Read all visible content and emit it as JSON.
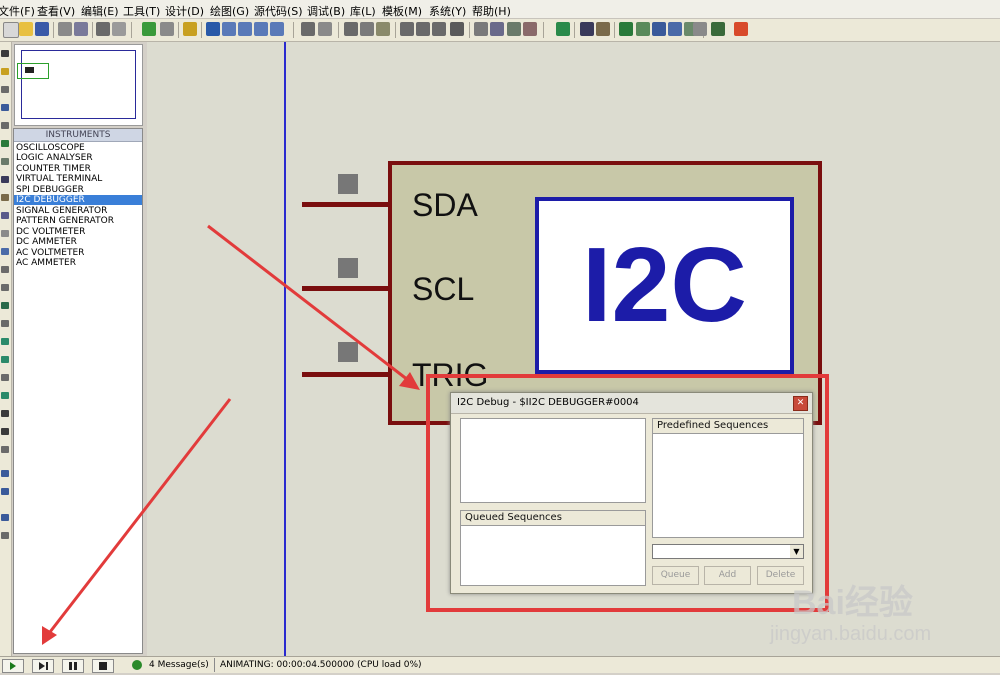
{
  "menu": [
    "文件(F)",
    "查看(V)",
    "编辑(E)",
    "工具(T)",
    "设计(D)",
    "绘图(G)",
    "源代码(S)",
    "调试(B)",
    "库(L)",
    "模板(M)",
    "系统(Y)",
    "帮助(H)"
  ],
  "instruments": {
    "header": "INSTRUMENTS",
    "items": [
      "OSCILLOSCOPE",
      "LOGIC ANALYSER",
      "COUNTER TIMER",
      "VIRTUAL TERMINAL",
      "SPI DEBUGGER",
      "I2C DEBUGGER",
      "SIGNAL GENERATOR",
      "PATTERN GENERATOR",
      "DC VOLTMETER",
      "DC AMMETER",
      "AC VOLTMETER",
      "AC AMMETER"
    ],
    "selected": "I2C DEBUGGER"
  },
  "component": {
    "pins": [
      "SDA",
      "SCL",
      "TRIG"
    ],
    "label": "I2C",
    "color_border": "#7a0e0e",
    "color_label": "#1c1ca8"
  },
  "dialog": {
    "title": "I2C Debug - $II2C DEBUGGER#0004",
    "predefined_header": "Predefined Sequences",
    "queued_header": "Queued Sequences",
    "buttons": [
      "Queue",
      "Add",
      "Delete"
    ],
    "close_glyph": "✕"
  },
  "status": {
    "messages": "4 Message(s)",
    "animating": "ANIMATING: 00:00:04.500000 (CPU load 0%)"
  },
  "watermark": {
    "brand": "Bai经验",
    "url": "jingyan.baidu.com"
  },
  "annotation_color": "#e23b3b"
}
